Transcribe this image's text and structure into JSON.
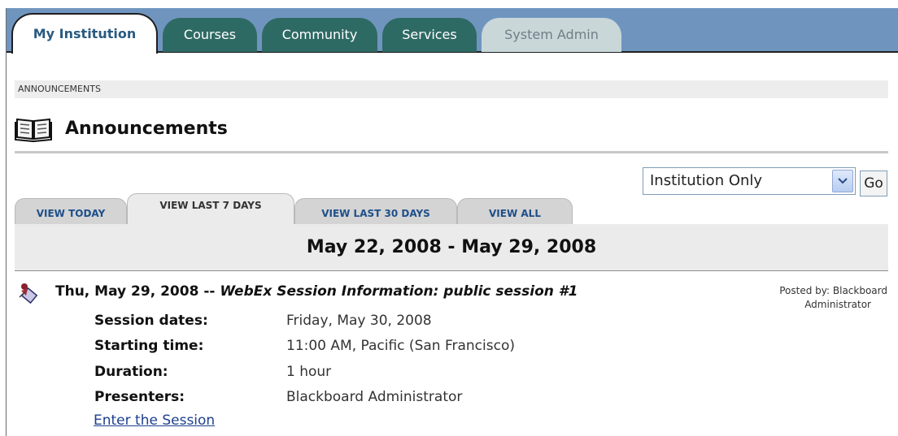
{
  "top_tabs": [
    {
      "label": "My Institution",
      "state": "active"
    },
    {
      "label": "Courses"
    },
    {
      "label": "Community"
    },
    {
      "label": "Services"
    },
    {
      "label": "System Admin",
      "state": "disabled"
    }
  ],
  "breadcrumb": "ANNOUNCEMENTS",
  "page_title": "Announcements",
  "filter": {
    "selected": "Institution Only",
    "go_label": "Go"
  },
  "view_tabs": [
    {
      "label": "VIEW TODAY"
    },
    {
      "label": "VIEW LAST 7 DAYS",
      "state": "active"
    },
    {
      "label": "VIEW LAST 30 DAYS"
    },
    {
      "label": "VIEW ALL"
    }
  ],
  "date_range": "May 22, 2008 - May 29, 2008",
  "announcement": {
    "date": "Thu, May 29, 2008",
    "separator": "--",
    "subject": "WebEx Session Information: public session #1",
    "posted_by_label": "Posted by:",
    "posted_by_first": "Blackboard",
    "posted_by_last": "Administrator",
    "details": [
      {
        "label": "Session dates:",
        "value": "Friday, May 30, 2008"
      },
      {
        "label": "Starting time:",
        "value": "11:00 AM, Pacific (San Francisco)"
      },
      {
        "label": "Duration:",
        "value": "1 hour"
      },
      {
        "label": "Presenters:",
        "value": "Blackboard Administrator"
      }
    ],
    "link_label": "Enter the Session"
  },
  "icons": {
    "title": "book-icon",
    "announcement": "announcement-icon",
    "dropdown": "chevron-down-icon"
  },
  "colors": {
    "topbar": "#6f95bf",
    "tab_green": "#2e6a64",
    "link": "#1d3f8f"
  }
}
